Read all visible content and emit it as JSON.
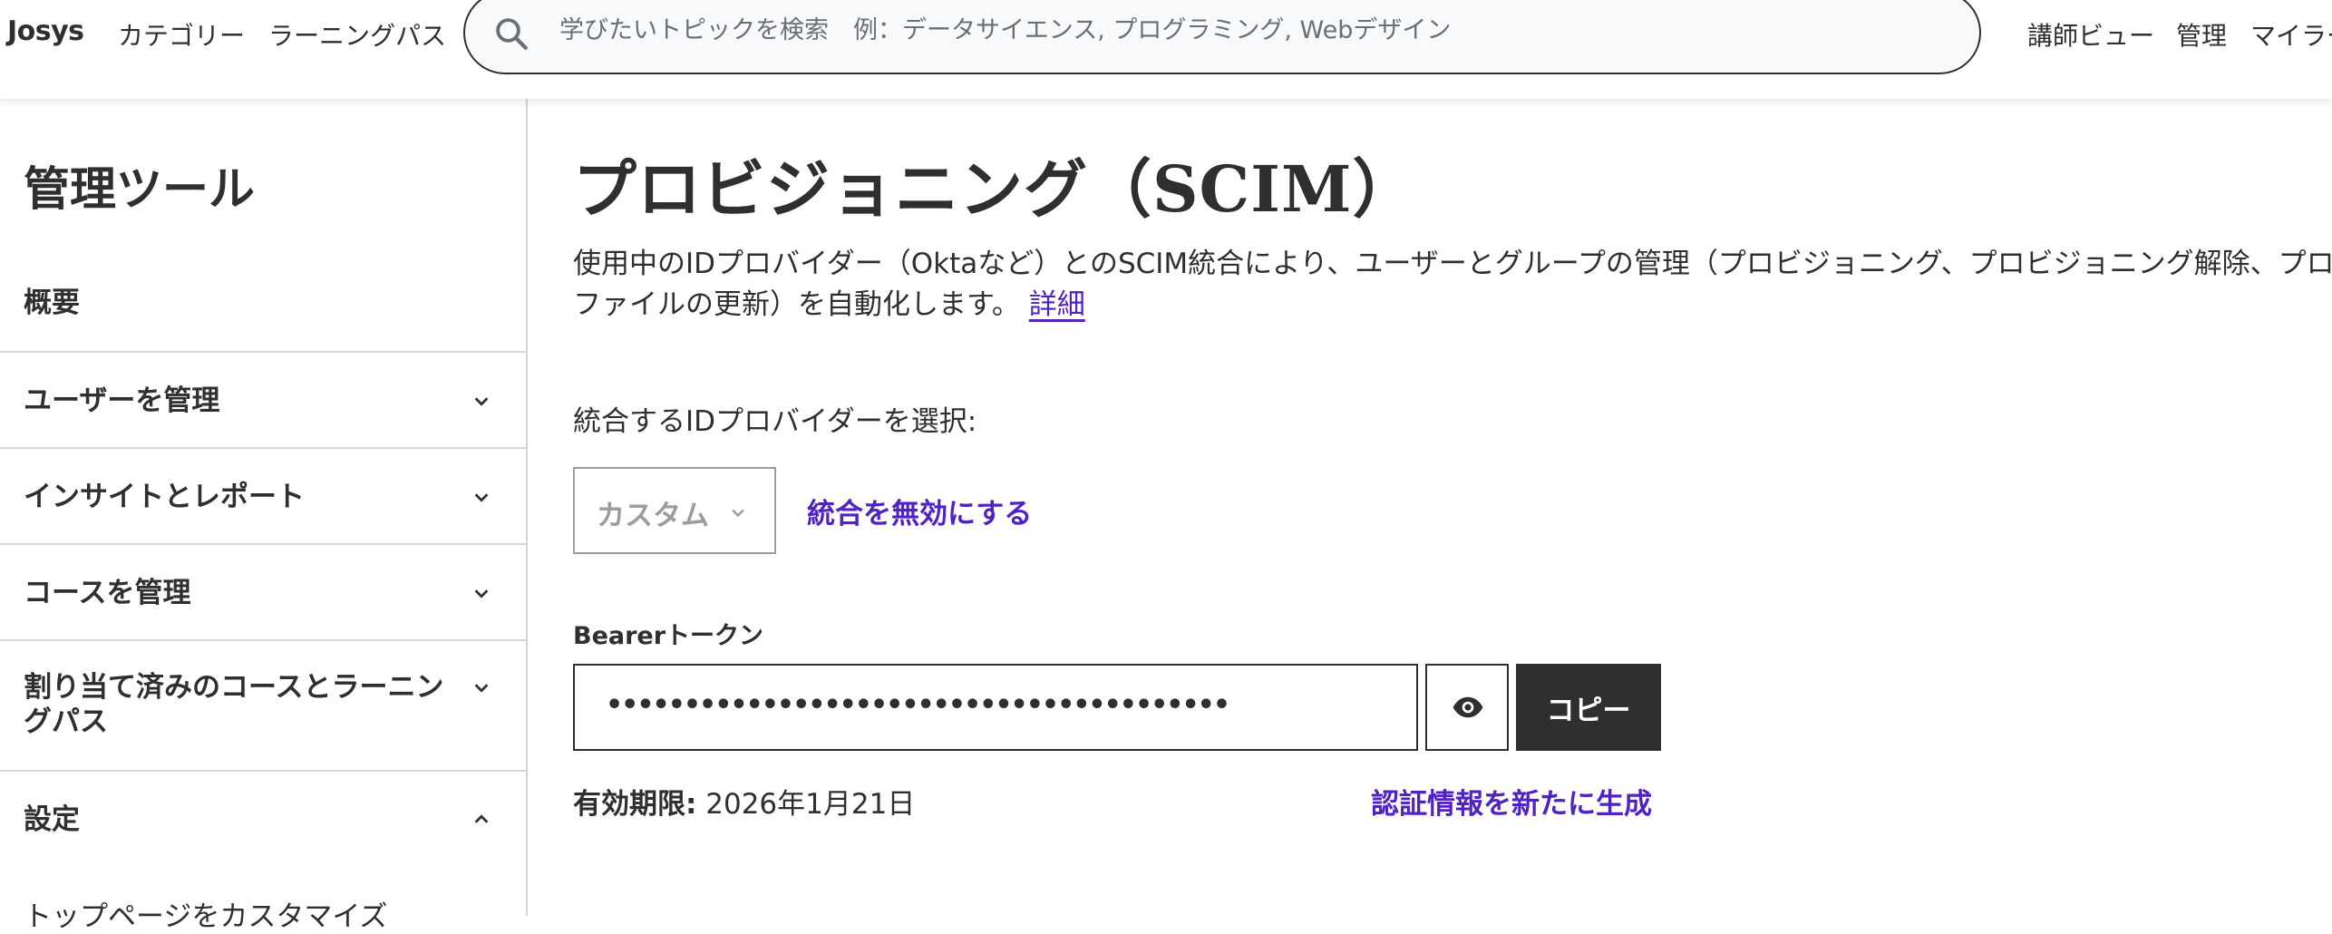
{
  "header": {
    "logo": "Josys",
    "nav_left": [
      "カテゴリー",
      "ラーニングパス"
    ],
    "search": {
      "placeholder": "学びたいトピックを検索　例：データサイエンス, プログラミング, Webデザイン",
      "icon": "search-icon"
    },
    "nav_right": [
      "講師ビュー",
      "管理",
      "マイラー"
    ]
  },
  "sidebar": {
    "title": "管理ツール",
    "items": [
      {
        "label": "概要"
      },
      {
        "label": "ユーザーを管理",
        "icon": "chevron-down-icon"
      },
      {
        "label": "インサイトとレポート",
        "icon": "chevron-down-icon"
      },
      {
        "label": "コースを管理",
        "icon": "chevron-down-icon"
      },
      {
        "label": "割り当て済みのコースとラーニングパス",
        "icon": "chevron-down-icon"
      },
      {
        "label": "設定",
        "icon": "chevron-up-icon"
      }
    ],
    "sub_item": "トップページをカスタマイズ"
  },
  "main": {
    "title": "プロビジョニング（SCIM）",
    "description": "使用中のIDプロバイダー（Oktaなど）とのSCIM統合により、ユーザーとグループの管理（プロビジョニング、プロビジョニング解除、プロファイルの更新）を自動化します。",
    "description_link": "詳細",
    "idp_label": "統合するIDプロバイダーを選択:",
    "idp_select_value": "カスタム",
    "disable_integration": "統合を無効にする",
    "token_label": "Bearerトークン",
    "token_masked": "••••••••••••••••••••••••••••••••••••••••",
    "show_token_icon": "eye-icon",
    "copy_button": "コピー",
    "expiry_label": "有効期限:",
    "expiry_value": " 2026年1月21日",
    "regenerate_link": "認証情報を新たに生成"
  },
  "colors": {
    "text": "#2d2f31",
    "accent_link": "#5022c3",
    "border": "#d1d7dc",
    "button_dark": "#2d2f31"
  }
}
